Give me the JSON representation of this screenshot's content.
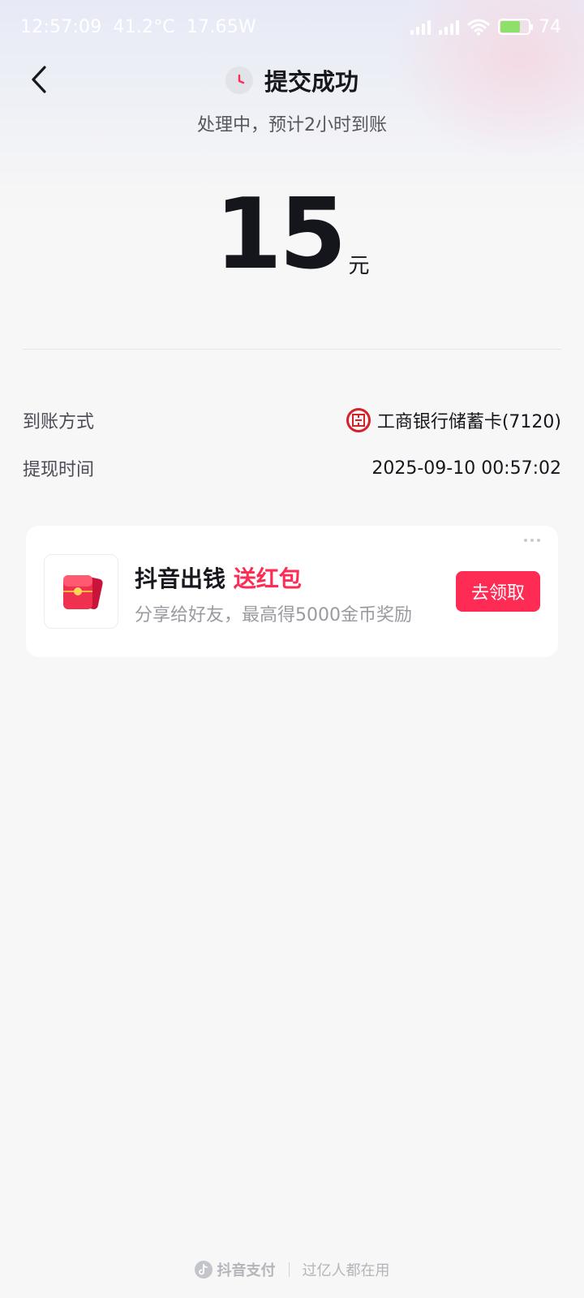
{
  "status_bar": {
    "time": "12:57:09",
    "temperature": "41.2°C",
    "power": "17.65W",
    "battery_level": "74"
  },
  "header": {
    "title": "提交成功",
    "subtitle": "处理中，预计2小时到账"
  },
  "amount": {
    "value": "15",
    "unit": "元"
  },
  "details": [
    {
      "label": "到账方式",
      "value": "工商银行储蓄卡(7120)"
    },
    {
      "label": "提现时间",
      "value": "2025-09-10 00:57:02"
    }
  ],
  "promo": {
    "title_main": "抖音出钱",
    "title_accent": "送红包",
    "description": "分享给好友，最高得5000金币奖励",
    "button_label": "去领取"
  },
  "footer": {
    "brand": "抖音支付",
    "tagline": "过亿人都在用"
  },
  "colors": {
    "accent": "#fe2c55",
    "bank_red": "#d6202a"
  },
  "icons": {
    "back": "back-arrow-icon",
    "status": "clock-icon",
    "bank": "icbc-logo-icon",
    "promo": "red-envelope-icon"
  }
}
